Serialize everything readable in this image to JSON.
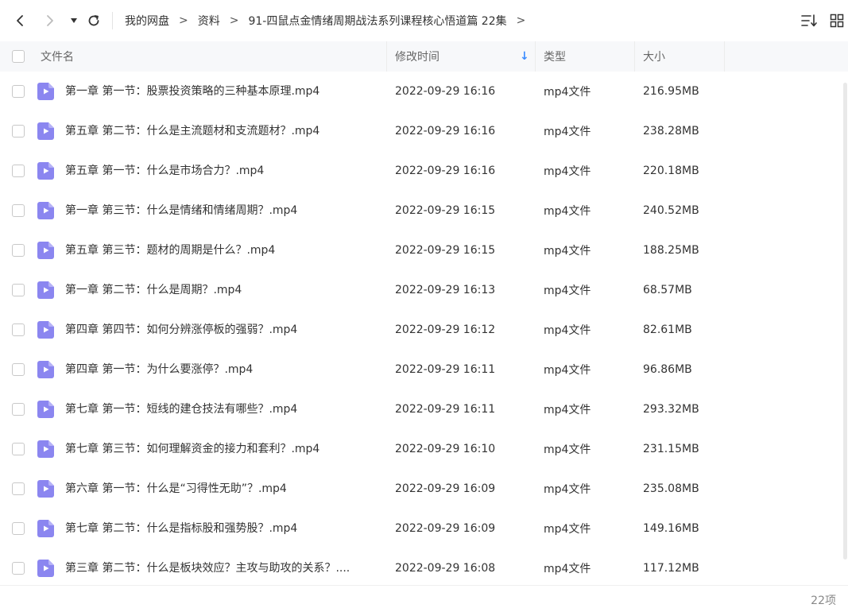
{
  "toolbar": {
    "breadcrumb": [
      "我的网盘",
      "资料",
      "91-四鼠点金情绪周期战法系列课程核心悟道篇 22集"
    ],
    "crumb_separator": ">"
  },
  "columns": {
    "name": "文件名",
    "time": "修改时间",
    "type": "类型",
    "size": "大小",
    "sort_indicator": "↓"
  },
  "files": [
    {
      "name": "第一章 第一节：股票投资策略的三种基本原理.mp4",
      "time": "2022-09-29 16:16",
      "type": "mp4文件",
      "size": "216.95MB"
    },
    {
      "name": "第五章 第二节：什么是主流题材和支流题材？.mp4",
      "time": "2022-09-29 16:16",
      "type": "mp4文件",
      "size": "238.28MB"
    },
    {
      "name": "第五章 第一节：什么是市场合力？.mp4",
      "time": "2022-09-29 16:16",
      "type": "mp4文件",
      "size": "220.18MB"
    },
    {
      "name": "第一章 第三节：什么是情绪和情绪周期？.mp4",
      "time": "2022-09-29 16:15",
      "type": "mp4文件",
      "size": "240.52MB"
    },
    {
      "name": "第五章 第三节：题材的周期是什么？.mp4",
      "time": "2022-09-29 16:15",
      "type": "mp4文件",
      "size": "188.25MB"
    },
    {
      "name": "第一章 第二节：什么是周期？.mp4",
      "time": "2022-09-29 16:13",
      "type": "mp4文件",
      "size": "68.57MB"
    },
    {
      "name": "第四章 第四节：如何分辨涨停板的强弱？.mp4",
      "time": "2022-09-29 16:12",
      "type": "mp4文件",
      "size": "82.61MB"
    },
    {
      "name": "第四章 第一节：为什么要涨停？.mp4",
      "time": "2022-09-29 16:11",
      "type": "mp4文件",
      "size": "96.86MB"
    },
    {
      "name": "第七章 第一节：短线的建仓技法有哪些？.mp4",
      "time": "2022-09-29 16:11",
      "type": "mp4文件",
      "size": "293.32MB"
    },
    {
      "name": "第七章 第三节：如何理解资金的接力和套利？.mp4",
      "time": "2022-09-29 16:10",
      "type": "mp4文件",
      "size": "231.15MB"
    },
    {
      "name": "第六章 第一节：什么是“习得性无助”？.mp4",
      "time": "2022-09-29 16:09",
      "type": "mp4文件",
      "size": "235.08MB"
    },
    {
      "name": "第七章 第二节：什么是指标股和强势股？.mp4",
      "time": "2022-09-29 16:09",
      "type": "mp4文件",
      "size": "149.16MB"
    },
    {
      "name": "第三章 第二节：什么是板块效应？主攻与助攻的关系？....",
      "time": "2022-09-29 16:08",
      "type": "mp4文件",
      "size": "117.12MB"
    }
  ],
  "footer": {
    "item_count": "22项"
  },
  "colors": {
    "file_icon": "#8b86f0",
    "sort_arrow": "#3b8cff",
    "header_bg": "#f7f8fa"
  },
  "icons": {
    "back": "chevron-left-icon",
    "forward": "chevron-right-icon",
    "history": "triangle-down-icon",
    "refresh": "refresh-icon",
    "sort": "sort-icon",
    "view": "grid-view-icon",
    "file": "video-file-icon"
  }
}
